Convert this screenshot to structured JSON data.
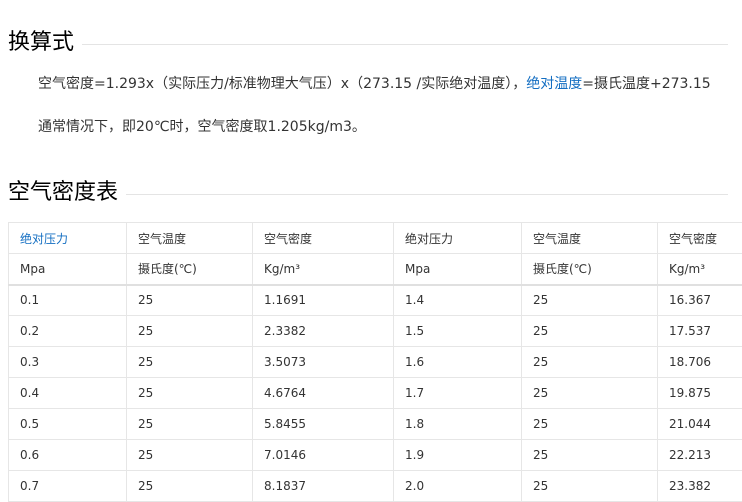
{
  "section1": {
    "title": "换算式"
  },
  "formula": {
    "prefix": "空气密度=1.293x（实际压力/标准物理大气压）x（273.15 /实际绝对温度），",
    "link_text": "绝对温度",
    "suffix": "=摄氏温度+273.15"
  },
  "note": "通常情况下，即20℃时，空气密度取1.205kg/m3。",
  "section2": {
    "title": "空气密度表"
  },
  "table": {
    "headers": [
      "绝对压力",
      "空气温度",
      "空气密度",
      "绝对压力",
      "空气温度",
      "空气密度"
    ],
    "units": [
      "Mpa",
      "摄氏度(℃)",
      "Kg/m³",
      "Mpa",
      "摄氏度(℃)",
      "Kg/m³"
    ],
    "rows": [
      [
        "0.1",
        "25",
        "1.1691",
        "1.4",
        "25",
        "16.367"
      ],
      [
        "0.2",
        "25",
        "2.3382",
        "1.5",
        "25",
        "17.537"
      ],
      [
        "0.3",
        "25",
        "3.5073",
        "1.6",
        "25",
        "18.706"
      ],
      [
        "0.4",
        "25",
        "4.6764",
        "1.7",
        "25",
        "19.875"
      ],
      [
        "0.5",
        "25",
        "5.8455",
        "1.8",
        "25",
        "21.044"
      ],
      [
        "0.6",
        "25",
        "7.0146",
        "1.9",
        "25",
        "22.213"
      ],
      [
        "0.7",
        "25",
        "8.1837",
        "2.0",
        "25",
        "23.382"
      ]
    ]
  },
  "colors": {
    "link": "#136ec2",
    "text": "#333333",
    "heading": "#000000",
    "border": "#e6e6e6"
  }
}
